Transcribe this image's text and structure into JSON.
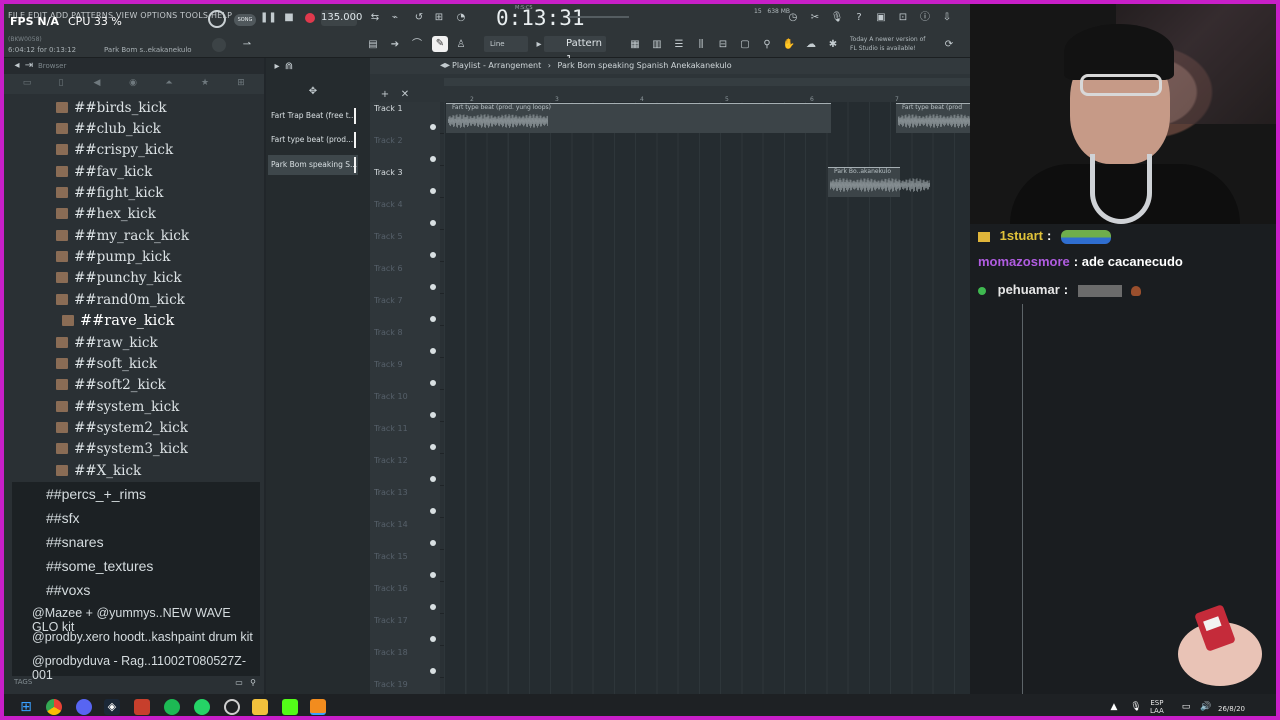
{
  "toolbar": {
    "menu": "FILE EDIT ADD PATTERNS VIEW OPTIONS TOOLS HELP",
    "fps": "FPS N/A",
    "cpu": "CPU 33 %",
    "song_mode": "SONG",
    "tempo": "135.000",
    "clock_label": "M:S:CS",
    "clock": "0:13:31",
    "memory": "638 MB",
    "memory_count": "15",
    "hint_small": "(BKW0058)",
    "hint_time": "6:04:12 for 0:13:12",
    "hint_file": "Park Bom s..ekakanekulo",
    "snap_mode": "Line",
    "pattern": "Pattern 1",
    "news_line1": "Today  A newer version of",
    "news_line2": "FL Studio is available!"
  },
  "browser": {
    "header": "Browser",
    "items": [
      {
        "label": "##birds_kick"
      },
      {
        "label": "##club_kick"
      },
      {
        "label": "##crispy_kick"
      },
      {
        "label": "##fav_kick"
      },
      {
        "label": "##fight_kick"
      },
      {
        "label": "##hex_kick"
      },
      {
        "label": "##my_rack_kick"
      },
      {
        "label": "##pump_kick"
      },
      {
        "label": "##punchy_kick"
      },
      {
        "label": "##rand0m_kick"
      },
      {
        "label": "##rave_kick"
      },
      {
        "label": "##raw_kick"
      },
      {
        "label": "##soft_kick"
      },
      {
        "label": "##soft2_kick"
      },
      {
        "label": "##system_kick"
      },
      {
        "label": "##system2_kick"
      },
      {
        "label": "##system3_kick"
      },
      {
        "label": "##X_kick"
      }
    ],
    "lower": [
      {
        "label": "##percs_+_rims"
      },
      {
        "label": "##sfx"
      },
      {
        "label": "##snares"
      },
      {
        "label": "##some_textures"
      },
      {
        "label": "##voxs"
      },
      {
        "label": "@Mazee + @yummys..NEW WAVE GLO kit"
      },
      {
        "label": "@prodby.xero hoodt..kashpaint drum kit"
      },
      {
        "label": "@prodbyduva - Rag..11002T080527Z-001"
      }
    ],
    "tags": "TAGS"
  },
  "patterns": [
    {
      "label": "Fart Trap Beat (free t..."
    },
    {
      "label": "Fart type beat (prod..."
    },
    {
      "label": "Park Bom speaking S..."
    }
  ],
  "playlist": {
    "title": "Playlist - Arrangement",
    "breadcrumb": "Park Bom speaking Spanish Anekakanekulo",
    "ruler": [
      "2",
      "3",
      "4",
      "5",
      "6",
      "7"
    ],
    "tracks": [
      {
        "label": "Track 1"
      },
      {
        "label": "Track 2"
      },
      {
        "label": "Track 3"
      },
      {
        "label": "Track 4"
      },
      {
        "label": "Track 5"
      },
      {
        "label": "Track 6"
      },
      {
        "label": "Track 7"
      },
      {
        "label": "Track 8"
      },
      {
        "label": "Track 9"
      },
      {
        "label": "Track 10"
      },
      {
        "label": "Track 11"
      },
      {
        "label": "Track 12"
      },
      {
        "label": "Track 13"
      },
      {
        "label": "Track 14"
      },
      {
        "label": "Track 15"
      },
      {
        "label": "Track 16"
      },
      {
        "label": "Track 17"
      },
      {
        "label": "Track 18"
      },
      {
        "label": "Track 19"
      }
    ],
    "clips": [
      {
        "name": "Fart type beat (prod. yung loops)"
      },
      {
        "name": "Fart type beat (prod"
      },
      {
        "name": "Park Bo..akanekulo"
      }
    ]
  },
  "chat": [
    {
      "user": "1stuart",
      "sep": ":",
      "text": "",
      "color": "#e0c23a"
    },
    {
      "user": "momazosmore",
      "sep": ":",
      "text": "ade cacanecudo",
      "color": "#b05ce0"
    },
    {
      "user": "pehuamar",
      "sep": ":",
      "text": "",
      "color": "#ffffff"
    }
  ],
  "taskbar": {
    "lang1": "ESP",
    "lang2": "LAA",
    "date": "26/8/20"
  }
}
